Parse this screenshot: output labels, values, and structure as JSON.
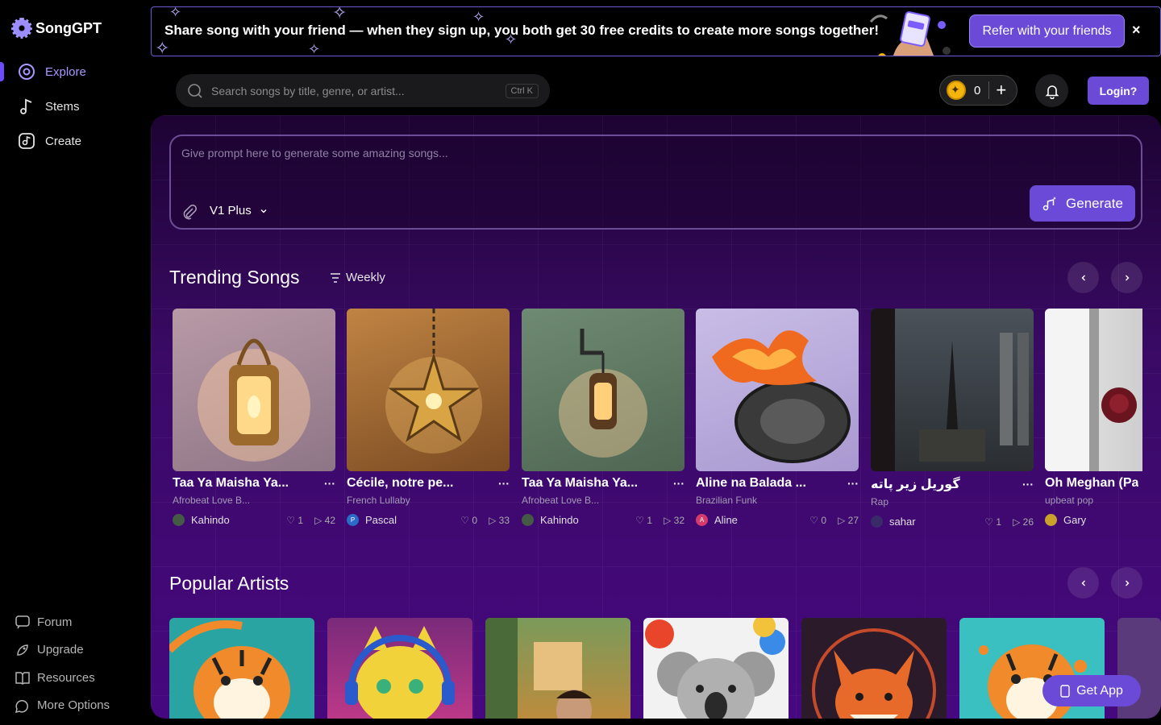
{
  "app": {
    "name": "SongGPT"
  },
  "sidebar": {
    "items": [
      {
        "label": "Explore",
        "icon": "explore-icon"
      },
      {
        "label": "Stems",
        "icon": "music-note-icon"
      },
      {
        "label": "Create",
        "icon": "create-music-icon"
      }
    ],
    "bottom": [
      {
        "label": "Forum",
        "icon": "chat-icon"
      },
      {
        "label": "Upgrade",
        "icon": "rocket-icon"
      },
      {
        "label": "Resources",
        "icon": "book-icon"
      },
      {
        "label": "More Options",
        "icon": "more-icon"
      }
    ]
  },
  "banner": {
    "text": "Share song with your friend — when they sign up, you both get 30 free credits to create more songs together!",
    "cta": "Refer with your friends",
    "close": "×"
  },
  "search": {
    "placeholder": "Search songs by title, genre, or artist...",
    "shortcut": "Ctrl K"
  },
  "credits": {
    "value": "0",
    "plus": "+"
  },
  "login": "Login?",
  "prompt": {
    "placeholder": "Give prompt here to generate some amazing songs...",
    "model": "V1 Plus",
    "generate": "Generate"
  },
  "trending": {
    "title": "Trending Songs",
    "filter": "Weekly",
    "songs": [
      {
        "title": "Taa Ya Maisha Ya...",
        "genre": "Afrobeat Love B...",
        "artist": "Kahindo",
        "likes": "1",
        "plays": "42"
      },
      {
        "title": "Cécile, notre pe...",
        "genre": "French Lullaby",
        "artist": "Pascal",
        "likes": "0",
        "plays": "33"
      },
      {
        "title": "Taa Ya Maisha Ya...",
        "genre": "Afrobeat Love B...",
        "artist": "Kahindo",
        "likes": "1",
        "plays": "32"
      },
      {
        "title": "Aline na Balada ...",
        "genre": "Brazilian Funk",
        "artist": "Aline",
        "likes": "0",
        "plays": "27"
      },
      {
        "title": "گوریل زیر پاته",
        "genre": "Rap",
        "artist": "sahar",
        "likes": "1",
        "plays": "26"
      },
      {
        "title": "Oh Meghan (Pa",
        "genre": "upbeat pop",
        "artist": "Gary",
        "likes": "",
        "plays": ""
      }
    ]
  },
  "popular": {
    "title": "Popular Artists"
  },
  "get_app": "Get App",
  "colors": {
    "accent": "#6a4ad7",
    "panel": "#3a0a66"
  }
}
